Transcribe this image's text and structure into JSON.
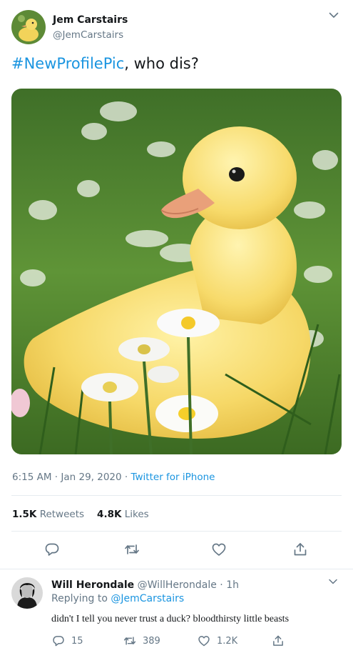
{
  "tweet": {
    "author_name": "Jem Carstairs",
    "author_handle": "@JemCarstairs",
    "text_hashtag": "#NewProfilePic",
    "text_rest": ", who dis?",
    "time": "6:15 AM",
    "date": "Jan 29, 2020",
    "source": "Twitter for iPhone",
    "retweets_count": "1.5K",
    "retweets_label": "Retweets",
    "likes_count": "4.8K",
    "likes_label": "Likes",
    "icons": [
      "reply-icon",
      "retweet-icon",
      "like-icon",
      "share-icon",
      "chevron-down-icon"
    ]
  },
  "reply": {
    "author_name": "Will Herondale",
    "author_handle": "@WillHerondale",
    "age": "1h",
    "replying_label": "Replying to",
    "replying_to": "@JemCarstairs",
    "text": "didn't I tell you never trust a duck? bloodthirsty little beasts",
    "reply_count": "15",
    "retweet_count": "389",
    "like_count": "1.2K"
  },
  "colors": {
    "link": "#1b95e0",
    "secondary_text": "#657786",
    "divider": "#e6ecf0"
  }
}
